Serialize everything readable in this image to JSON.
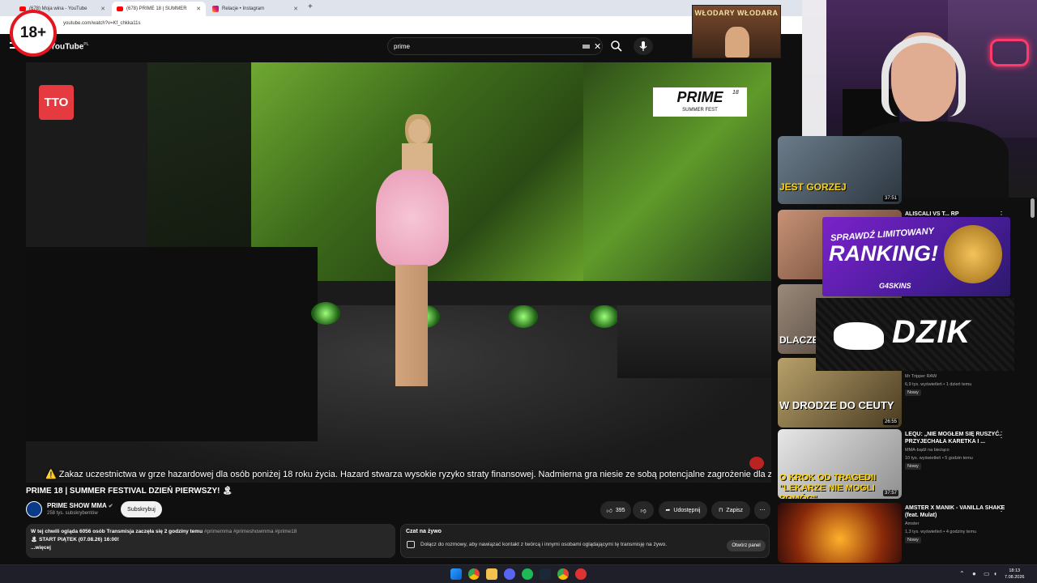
{
  "browser": {
    "tabs": [
      {
        "title": "(678) Moja wina - YouTube",
        "active": false
      },
      {
        "title": "(678) PRIME 18 | SUMMER",
        "active": true
      },
      {
        "title": "Relacje • Instagram",
        "active": false
      }
    ],
    "new_tab": "+",
    "url": "youtube.com/watch?v=Kf_chkka11s"
  },
  "overlay": {
    "age_badge": "18+",
    "top_logo": "WŁODARY WŁODARA"
  },
  "youtube": {
    "logo": "YouTube",
    "logo_region": "PL",
    "search_value": "prime",
    "clear": "✕"
  },
  "video": {
    "watermark": "TTO",
    "prime_logo": "PRIME",
    "prime_num": "18",
    "prime_sub": "SUMMER FEST",
    "warning": "⚠️ Zakaz uczestnictwa w grze hazardowej dla osób poniżej 18 roku życia. Hazard stwarza wysokie ryzyko straty finansowej. Nadmierna gra niesie ze sobą potencjalne zagrożenie dla zdrowia ⚠️"
  },
  "meta": {
    "title": "PRIME 18 | SUMMER FESTIVAL DZIEŃ PIERWSZY! 🏝",
    "channel": "PRIME SHOW MMA",
    "subs": "258 tys. subskrybentów",
    "subscribe": "Subskrybuj",
    "likes": "395",
    "share": "Udostępnij",
    "save": "Zapisz",
    "more": "⋯"
  },
  "description": {
    "line1_a": "W tej chwili ogląda 6056 osób  Transmisja zaczęła się 2 godziny temu ",
    "line1_b": "#primemma #primeshowmma #prime18",
    "line2": "START PIĄTEK (07.08.26) 16:00!",
    "more": "...więcej"
  },
  "chat": {
    "title": "Czat na żywo",
    "text": "Dołącz do rozmowy, aby nawiązać kontakt z twórcą i innymi osobami oglądającymi tę transmisję na żywo.",
    "open": "Otwórz panel"
  },
  "sidebar": {
    "items": [
      {
        "cap": "JEST GORZEJ",
        "dur": "37:51",
        "title": "",
        "channel": "",
        "stats": "",
        "badge": ""
      },
      {
        "cap": "",
        "dur": "",
        "title": "ALISCALI VS T... RP",
        "channel": "",
        "stats": "",
        "badge": ""
      },
      {
        "cap": "DLACZEGO",
        "dur": "",
        "title": "",
        "channel": "",
        "stats": "",
        "badge": ""
      },
      {
        "cap": "W DRODZE DO CEUTY",
        "dur": "26:55",
        "title": "",
        "channel": "Mr Tripper RAW",
        "stats": "6,9 tys. wyświetleń • 1 dzień temu",
        "badge": "Nowy"
      },
      {
        "cap": "O KROK OD TRAGEDII \"LEKARZE NIE MOGLI POMÓC\"",
        "dur": "37:57",
        "title": "LEQU: „NIE MOGŁEM SIĘ RUSZYĆ. PRZYJECHAŁA KARETKA I ...",
        "channel": "MMA-bądź na bieżąco",
        "stats": "10 tys. wyświetleń • 5 godzin temu",
        "badge": "Nowy"
      },
      {
        "cap": "",
        "dur": "",
        "title": "AMSTER X MANIK - VANILLA SHAKE (feat. Mulat)",
        "channel": "Amster",
        "stats": "1,3 tys. wyświetleń • 4 godziny temu",
        "badge": "Nowy"
      }
    ]
  },
  "ads": {
    "ad1_top": "SPRAWDŹ LIMITOWANY",
    "ad1_main": "RANKING!",
    "ad1_brand": "G4SKINS",
    "ad2_main": "DZIK"
  },
  "taskbar": {
    "time": "18:13",
    "date": "7.08.2026"
  },
  "colors": {
    "yt_bg": "#0f0f0f",
    "accent_red": "#e5141f",
    "stage_green": "#6fa832"
  }
}
